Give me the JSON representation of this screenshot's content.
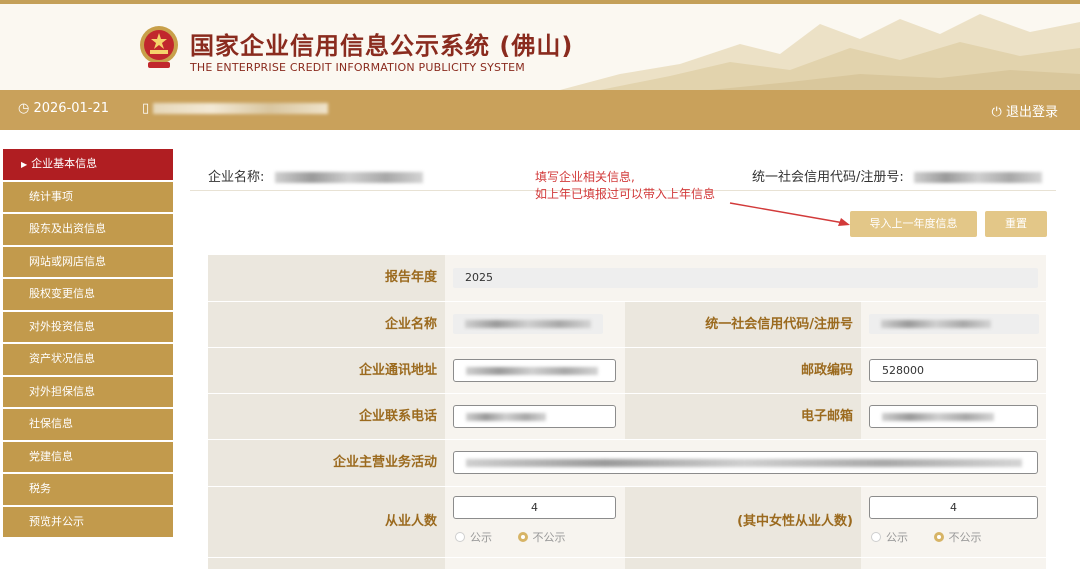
{
  "header": {
    "title": "国家企业信用信息公示系统 (佛山)",
    "subtitle": "THE ENTERPRISE CREDIT INFORMATION PUBLICITY SYSTEM"
  },
  "infobar": {
    "date": "2026-01-21",
    "logout_label": "退出登录"
  },
  "sidebar": {
    "items": [
      {
        "label": "企业基本信息",
        "active": true
      },
      {
        "label": "统计事项"
      },
      {
        "label": "股东及出资信息"
      },
      {
        "label": "网站或网店信息"
      },
      {
        "label": "股权变更信息"
      },
      {
        "label": "对外投资信息"
      },
      {
        "label": "资产状况信息"
      },
      {
        "label": "对外担保信息"
      },
      {
        "label": "社保信息"
      },
      {
        "label": "党建信息"
      },
      {
        "label": "税务"
      },
      {
        "label": "预览并公示"
      }
    ]
  },
  "main": {
    "company_name_label": "企业名称:",
    "credit_code_label": "统一社会信用代码/注册号:",
    "annotation_line1": "填写企业相关信息,",
    "annotation_line2": "如上年已填报过可以带入上年信息",
    "import_button": "导入上一年度信息",
    "reset_button": "重置"
  },
  "form": {
    "report_year_label": "报告年度",
    "report_year_value": "2025",
    "company_name_label": "企业名称",
    "credit_code_label": "统一社会信用代码/注册号",
    "address_label": "企业通讯地址",
    "postcode_label": "邮政编码",
    "postcode_value": "528000",
    "phone_label": "企业联系电话",
    "email_label": "电子邮箱",
    "business_label": "企业主营业务活动",
    "employees_label": "从业人数",
    "employees_value": "4",
    "female_employees_label": "(其中女性从业人数)",
    "female_employees_value": "4",
    "public_label": "公示",
    "nonpublic_label": "不公示",
    "employees_visibility": "不公示",
    "female_visibility": "不公示"
  },
  "colors": {
    "gold": "#c9a15b",
    "active_red": "#b01e22",
    "label_brown": "#9b6a1e",
    "annotation_red": "#d23a3a"
  }
}
